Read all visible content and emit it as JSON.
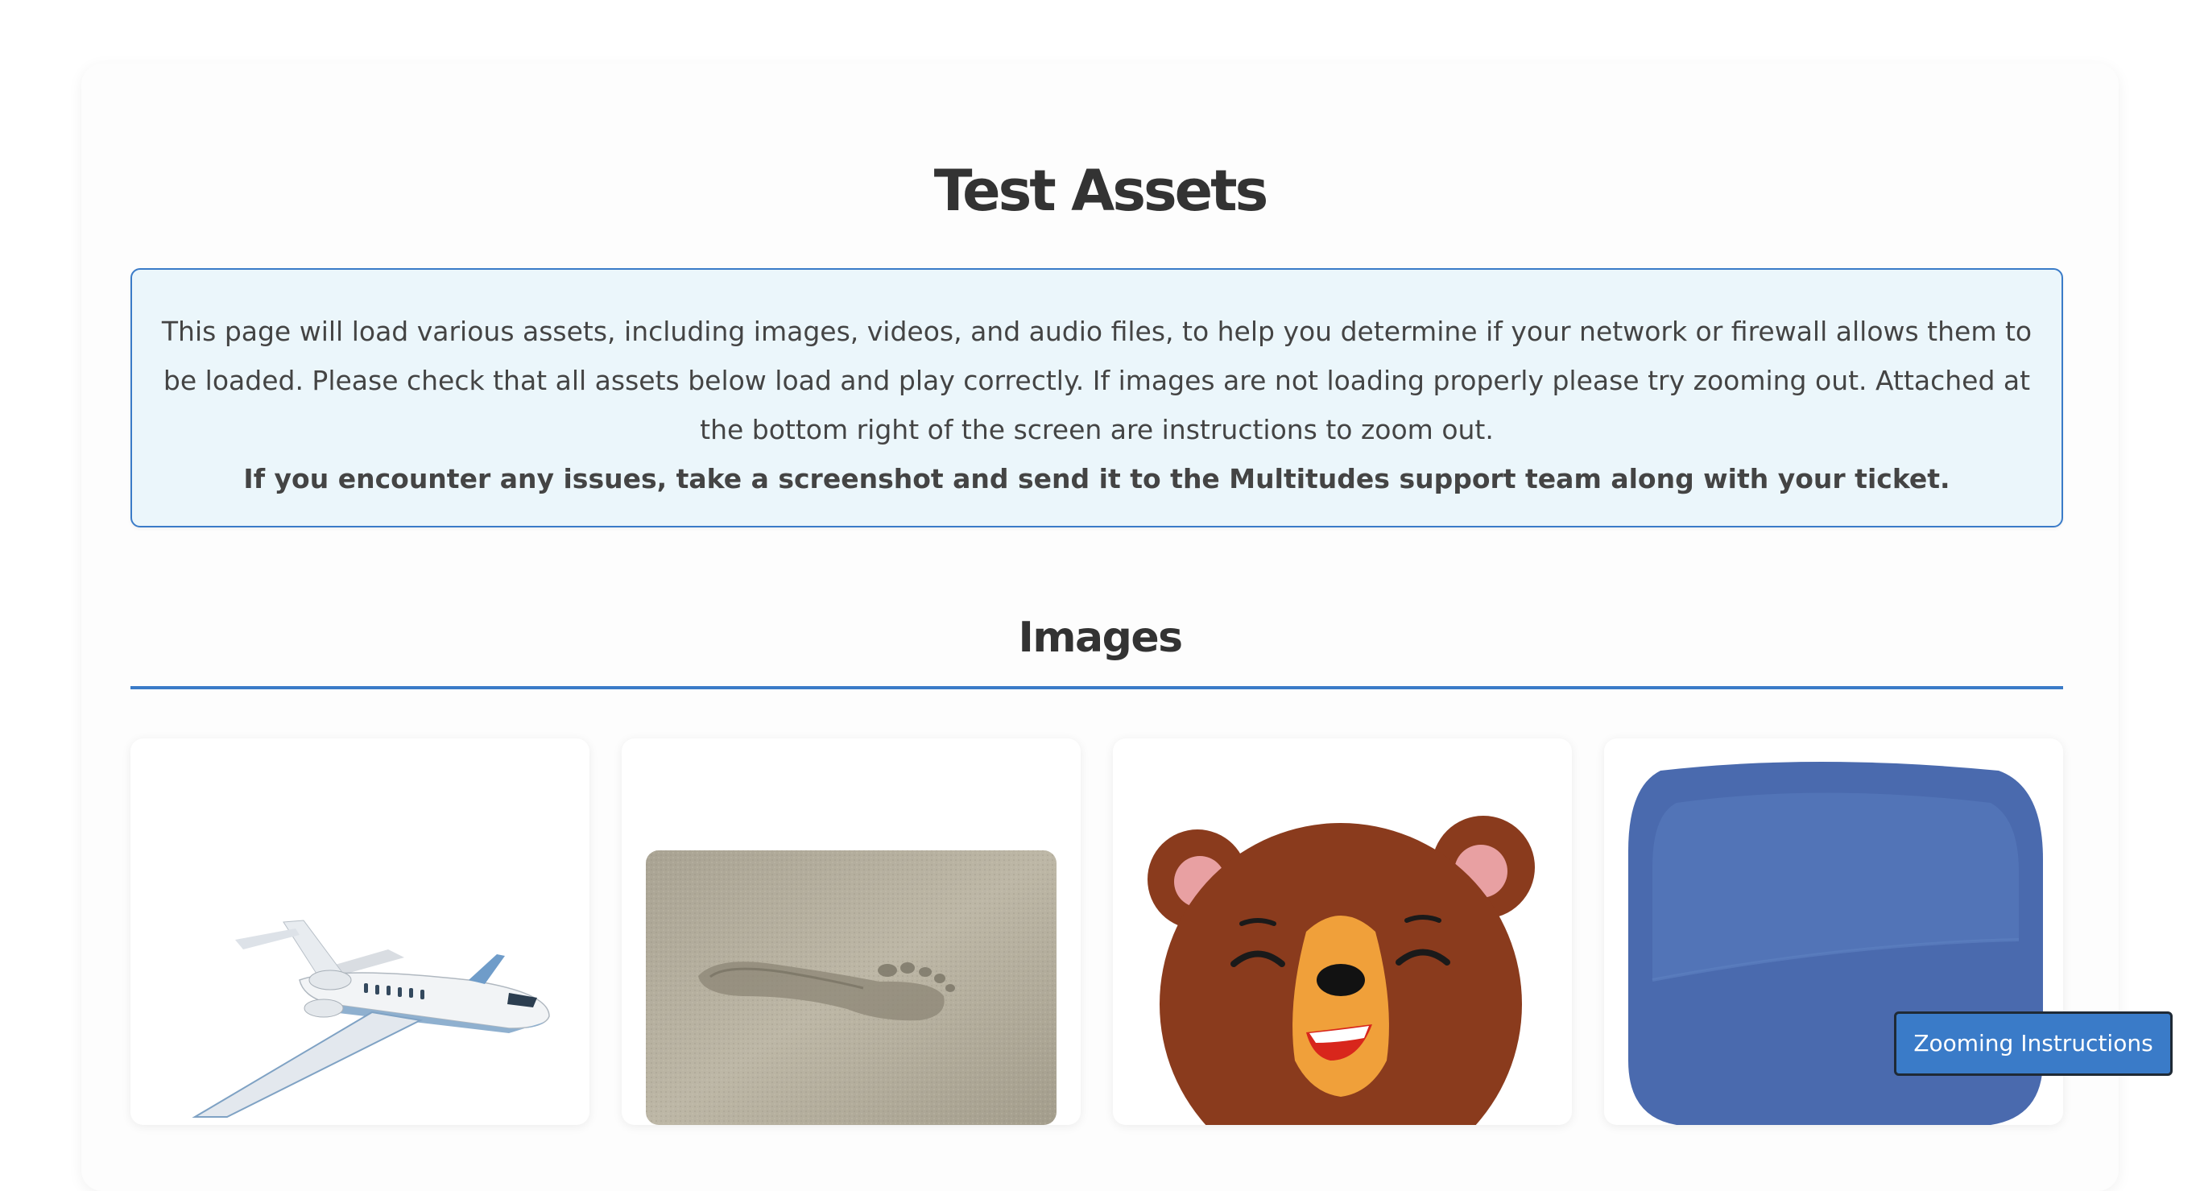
{
  "page": {
    "title": "Test Assets"
  },
  "info": {
    "paragraph": "This page will load various assets, including images, videos, and audio files, to help you determine if your network or firewall allows them to be loaded. Please check that all assets below load and play correctly. If images are not loading properly please try zooming out. Attached at the bottom right of the screen are instructions to zoom out.",
    "emphasis": "If you encounter any issues, take a screenshot and send it to the Multitudes support team along with your ticket."
  },
  "images_section": {
    "title": "Images",
    "items": [
      {
        "icon": "airplane-image"
      },
      {
        "icon": "footprint-image"
      },
      {
        "icon": "bear-image"
      },
      {
        "icon": "blue-shape-image"
      }
    ]
  },
  "zoom_button": {
    "label": "Zooming Instructions"
  },
  "colors": {
    "accent": "#3a7bc8",
    "info_bg": "#ebf6fb",
    "text": "#333333"
  }
}
